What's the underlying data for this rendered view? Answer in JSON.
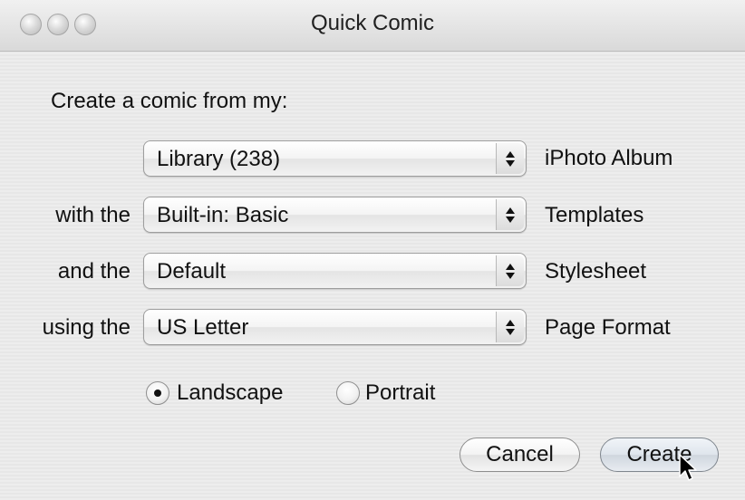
{
  "window": {
    "title": "Quick Comic"
  },
  "dialog": {
    "prompt": "Create a comic from my:",
    "rows": [
      {
        "label": "",
        "value": "Library (238)",
        "suffix": "iPhoto Album"
      },
      {
        "label": "with the",
        "value": "Built-in: Basic",
        "suffix": "Templates"
      },
      {
        "label": "and the",
        "value": "Default",
        "suffix": "Stylesheet"
      },
      {
        "label": "using the",
        "value": "US Letter",
        "suffix": "Page Format"
      }
    ],
    "orientation": {
      "options": [
        "Landscape",
        "Portrait"
      ],
      "selected": "Landscape"
    },
    "buttons": {
      "cancel": "Cancel",
      "create": "Create"
    }
  }
}
